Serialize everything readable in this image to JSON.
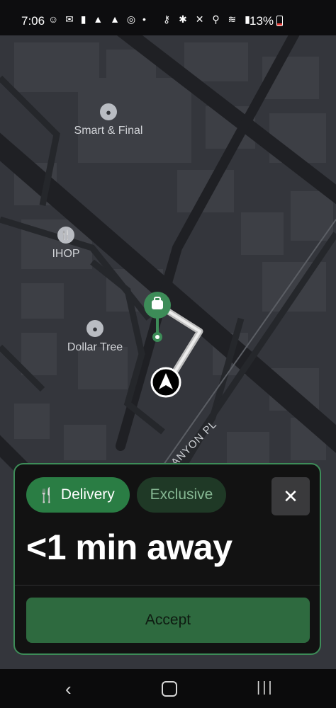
{
  "status_bar": {
    "time": "7:06",
    "left_icons": "☺ ✉ ▮ ▲ ▲ ◎ •",
    "right_icons": "⚷ ✱ ✕ ⚲ ≋ ▮",
    "battery": "13%"
  },
  "map": {
    "pois": [
      {
        "name": "Smart & Final",
        "icon": "pin"
      },
      {
        "name": "IHOP",
        "icon": "fork-knife"
      },
      {
        "name": "Dollar Tree",
        "icon": "pin"
      }
    ],
    "street_label": "GA CANYON PL",
    "colors": {
      "route": "#d9d9d9",
      "pickup": "#3d8c58"
    }
  },
  "offer": {
    "chip_delivery": "Delivery",
    "chip_exclusive": "Exclusive",
    "close_symbol": "✕",
    "eta": "<1 min away",
    "accept_label": "Accept"
  },
  "nav": {
    "back": "‹",
    "recent": "|||"
  }
}
